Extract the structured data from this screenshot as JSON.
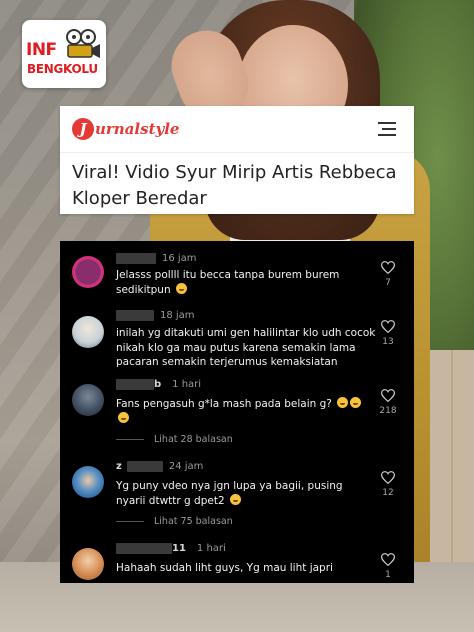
{
  "logo": {
    "line1": "INF",
    "line2": "BENGKOLU"
  },
  "article": {
    "brand": "urnalstyle",
    "brand_initial": "J",
    "headline": "Viral! Vidio Syur Mirip Artis Rebbeca Kloper Beredar"
  },
  "comments": [
    {
      "username": "",
      "time": "16 jam",
      "text": "Jelasss pollll itu becca tanpa burem burem sedikitpun",
      "emoji": "grinning-sweat",
      "likes": "7",
      "avatar_color": "#8a2d6b"
    },
    {
      "username": "",
      "time": "18 jam",
      "text": "inilah yg ditakuti umi gen halilintar klo udh cocok nikah klo ga mau putus karena semakin lama pacaran semakin terjerumus kemaksiatan",
      "emoji": "",
      "likes": "13",
      "avatar_color": "#c9d2d8"
    },
    {
      "username": "b",
      "time": "1 hari",
      "text": "Fans pengasuh g*la mash pada belain g?",
      "emoji": "laughing x3",
      "likes": "218",
      "avatar_color": "#3c4b5c"
    },
    {
      "username": "z",
      "time": "24 jam",
      "text": "Yg puny vdeo nya jgn lupa ya bagii, pusing nyarii dtwttr g dpet2",
      "emoji": "rofl",
      "likes": "12",
      "avatar_color": "#2f6aa3"
    },
    {
      "username": "11",
      "time": "1 hari",
      "text": "Hahaah sudah liht guys, Yg mau liht japri",
      "emoji": "",
      "likes": "1",
      "avatar_color": "#b5703d"
    }
  ],
  "replies": [
    {
      "label": "Lihat 28 balasan"
    },
    {
      "label": "Lihat 75 balasan"
    }
  ],
  "colors": {
    "accent": "#e53935",
    "panel": "#000000",
    "logo_red": "#e11b22"
  }
}
